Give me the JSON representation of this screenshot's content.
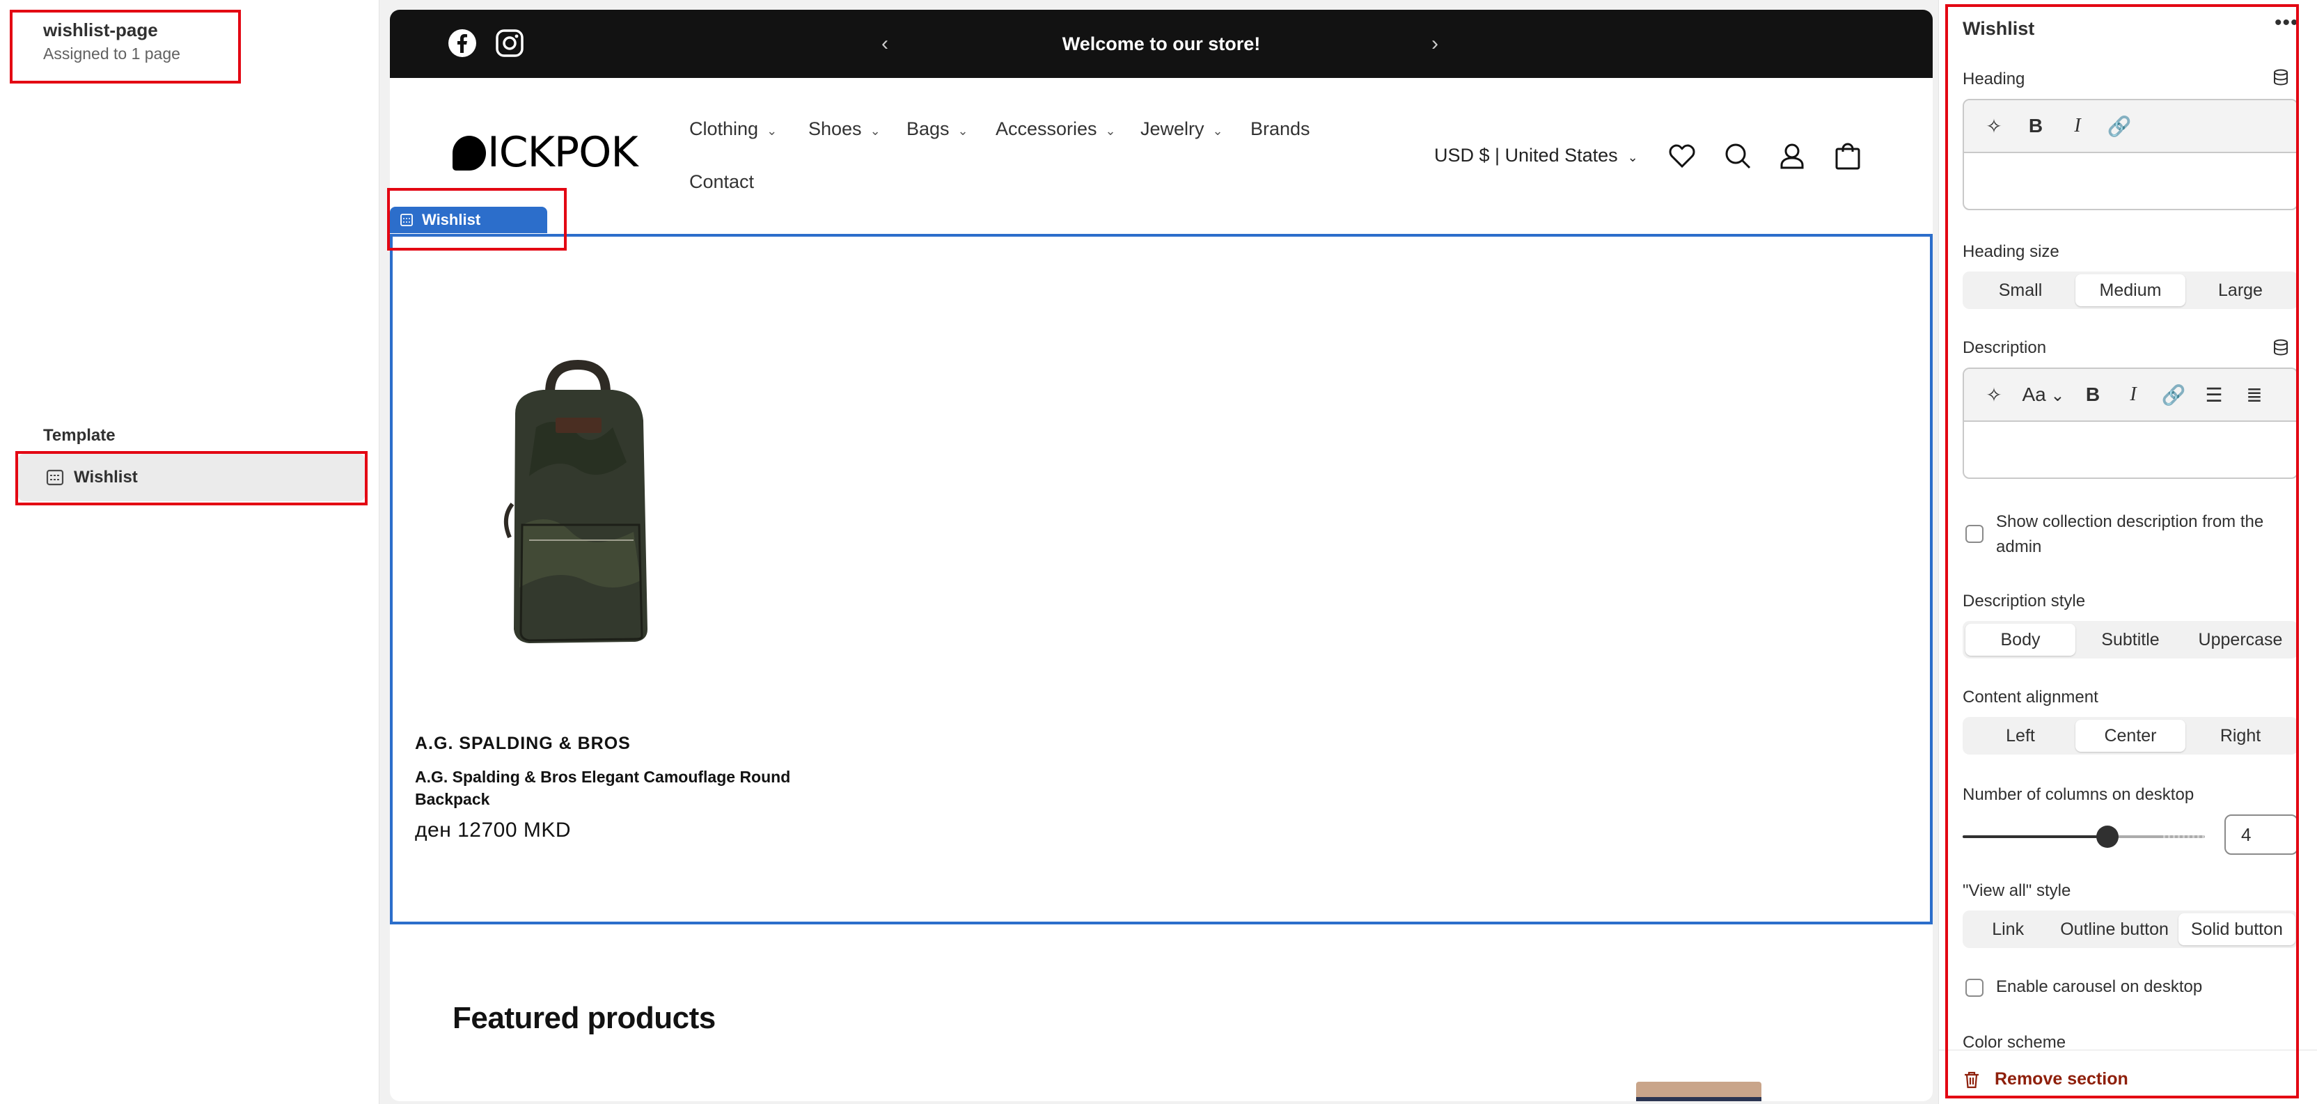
{
  "sidebar": {
    "template_name": "wishlist-page",
    "assigned": "Assigned to 1 page",
    "template_heading": "Template",
    "template_item": "Wishlist"
  },
  "preview": {
    "announcement": "Welcome to our store!",
    "logo": "ICKPOK",
    "nav": [
      "Clothing",
      "Shoes",
      "Bags",
      "Accessories",
      "Jewelry",
      "Brands",
      "Contact"
    ],
    "locale": "USD $ | United States",
    "section_tab": "Wishlist",
    "product": {
      "vendor": "A.G. SPALDING & BROS",
      "title": "A.G. Spalding & Bros Elegant Camouflage Round Backpack",
      "price": "ден 12700 MKD"
    },
    "featured_heading": "Featured products"
  },
  "panel": {
    "title": "Wishlist",
    "more": "•••",
    "heading_label": "Heading",
    "heading_size_label": "Heading size",
    "heading_size_options": [
      "Small",
      "Medium",
      "Large"
    ],
    "heading_size_selected": "Medium",
    "description_label": "Description",
    "rte_font_label": "Aa",
    "show_collection_desc": "Show collection description from the admin",
    "desc_style_label": "Description style",
    "desc_style_options": [
      "Body",
      "Subtitle",
      "Uppercase"
    ],
    "desc_style_selected": "Body",
    "alignment_label": "Content alignment",
    "alignment_options": [
      "Left",
      "Center",
      "Right"
    ],
    "alignment_selected": "Center",
    "columns_label": "Number of columns on desktop",
    "columns_value": "4",
    "columns_min": 1,
    "columns_max": 5,
    "view_all_label": "\"View all\" style",
    "view_all_options": [
      "Link",
      "Outline button",
      "Solid button"
    ],
    "view_all_selected": "Solid button",
    "carousel_label": "Enable carousel on desktop",
    "color_scheme_label": "Color scheme",
    "remove_label": "Remove section"
  },
  "colors": {
    "highlight": "#e30613",
    "selection": "#2c6ecb",
    "announcement_bg": "#121212",
    "danger": "#8e1f0b"
  }
}
